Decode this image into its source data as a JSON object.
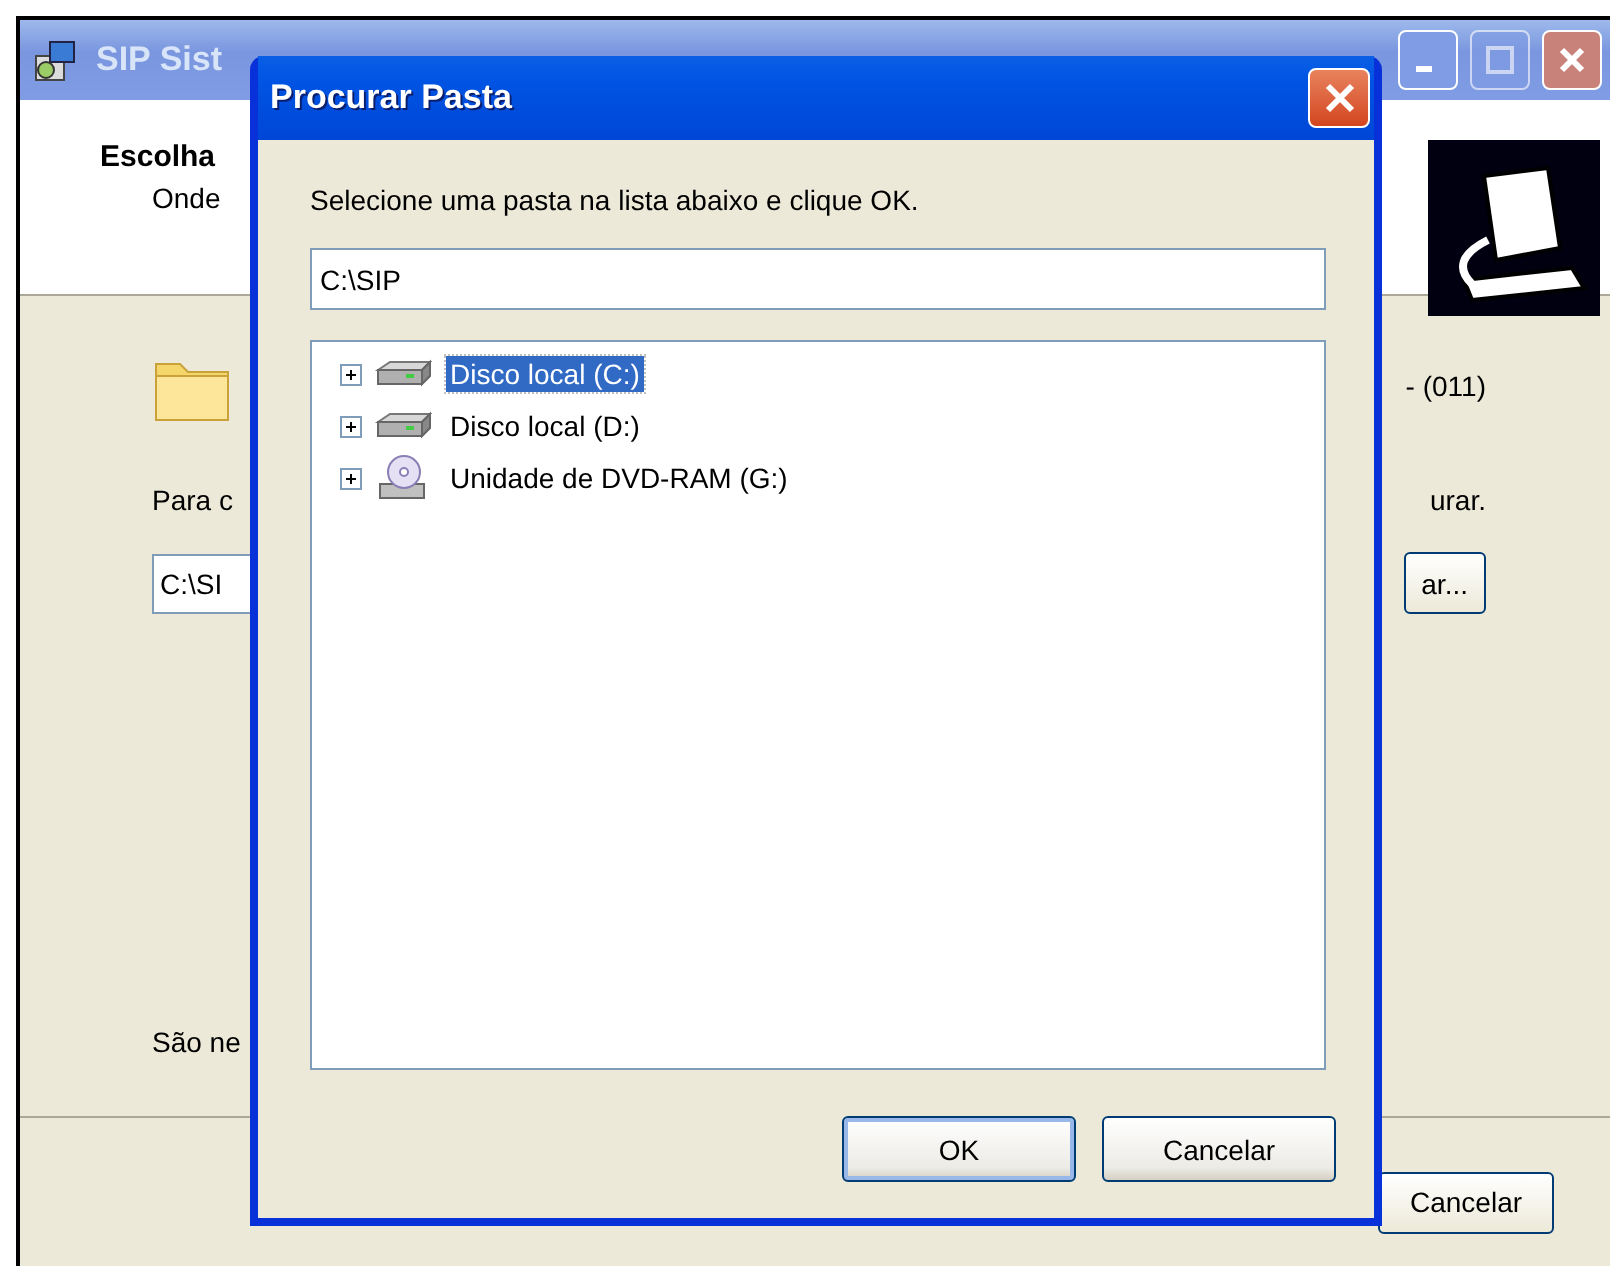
{
  "main_window": {
    "title": "SIP Sist",
    "header_title": "Escolha",
    "header_subtitle": "Onde",
    "phone_text": "- (011)",
    "hint_start": "Para c",
    "hint_end": "urar.",
    "path_field": {
      "value": "C:\\SI"
    },
    "browse_button": "ar...",
    "note": "São ne",
    "cancel_button": "Cancelar"
  },
  "dialog": {
    "title": "Procurar Pasta",
    "instruction": "Selecione uma pasta na lista abaixo e clique OK.",
    "path_field": {
      "value": "C:\\SIP"
    },
    "tree": [
      {
        "label": "Disco local (C:)",
        "kind": "disk",
        "selected": true,
        "expanded": false
      },
      {
        "label": "Disco local (D:)",
        "kind": "disk",
        "selected": false,
        "expanded": false
      },
      {
        "label": "Unidade de DVD-RAM (G:)",
        "kind": "dvd",
        "selected": false,
        "expanded": false
      }
    ],
    "buttons": [
      {
        "label": "OK",
        "default": true
      },
      {
        "label": "Cancelar",
        "default": false
      }
    ]
  }
}
